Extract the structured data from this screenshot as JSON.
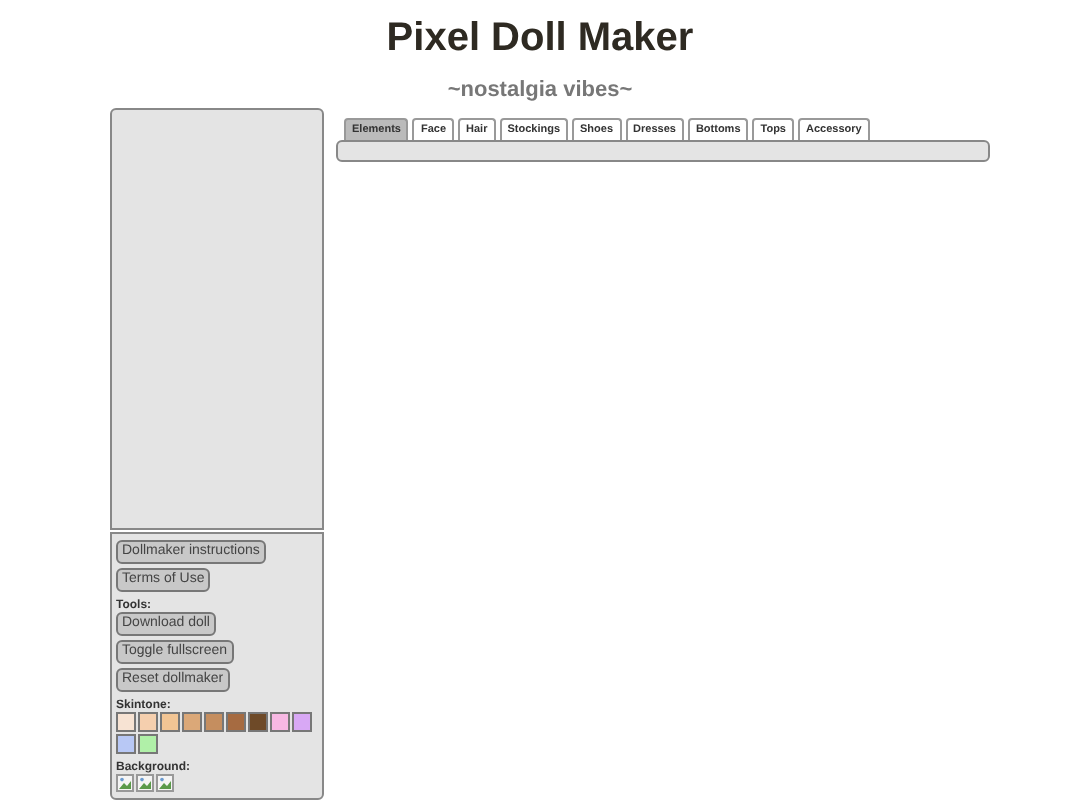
{
  "title": "Pixel Doll Maker",
  "subtitle": "~nostalgia vibes~",
  "links": [
    "Dollmaker instructions",
    "Terms of Use"
  ],
  "tools_label": "Tools:",
  "tools": [
    "Download doll",
    "Toggle fullscreen",
    "Reset dollmaker"
  ],
  "skintone_label": "Skintone:",
  "skintones": [
    {
      "color": "#f7e3d3"
    },
    {
      "color": "#f5cfae"
    },
    {
      "color": "#f2c594"
    },
    {
      "color": "#dba878"
    },
    {
      "color": "#c58e5f"
    },
    {
      "color": "#a66b41"
    },
    {
      "color": "#6e4a28"
    },
    {
      "color": "#f7b8e3"
    },
    {
      "color": "#d8a8f5"
    },
    {
      "color": "#b8c8f5"
    },
    {
      "color": "#b0f0a8"
    }
  ],
  "background_label": "Background:",
  "backgrounds": [
    {
      "kind": "picture"
    },
    {
      "kind": "picture"
    },
    {
      "kind": "picture"
    }
  ],
  "tabs": [
    {
      "label": "Elements",
      "selected": true
    },
    {
      "label": "Face",
      "selected": false
    },
    {
      "label": "Hair",
      "selected": false
    },
    {
      "label": "Stockings",
      "selected": false
    },
    {
      "label": "Shoes",
      "selected": false
    },
    {
      "label": "Dresses",
      "selected": false
    },
    {
      "label": "Bottoms",
      "selected": false
    },
    {
      "label": "Tops",
      "selected": false
    },
    {
      "label": "Accessory",
      "selected": false
    }
  ]
}
